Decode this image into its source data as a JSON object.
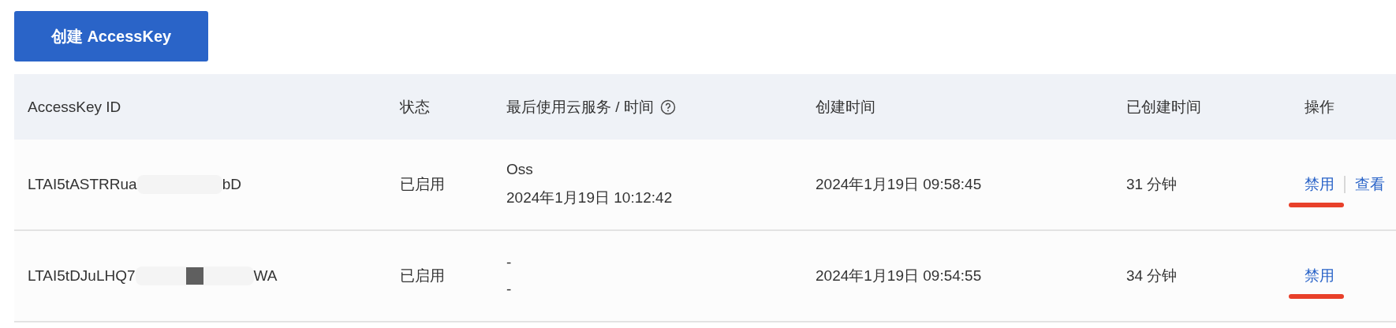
{
  "create_button": {
    "label": "创建 AccessKey"
  },
  "table": {
    "columns": [
      {
        "label": "AccessKey ID",
        "help": false
      },
      {
        "label": "状态",
        "help": false
      },
      {
        "label": "最后使用云服务 / 时间",
        "help": true
      },
      {
        "label": "创建时间",
        "help": false
      },
      {
        "label": "已创建时间",
        "help": false
      },
      {
        "label": "操作",
        "help": false
      }
    ],
    "rows": [
      {
        "id_start": "LTAI5tASTRRua",
        "id_end": "bD",
        "redaction": {
          "kind": "blur"
        },
        "status": "已启用",
        "last_service": "Oss",
        "last_time": "2024年1月19日 10:12:42",
        "created": "2024年1月19日 09:58:45",
        "age": "31 分钟",
        "actions": [
          {
            "label": "禁用",
            "underlined": true
          },
          {
            "label": "查看",
            "underlined": false
          }
        ]
      },
      {
        "id_start": "LTAI5tDJuLHQ7",
        "id_end": "WA",
        "redaction": {
          "kind": "block"
        },
        "status": "已启用",
        "last_service": "-",
        "last_time": "-",
        "created": "2024年1月19日 09:54:55",
        "age": "34 分钟",
        "actions": [
          {
            "label": "禁用",
            "underlined": true
          }
        ]
      }
    ]
  }
}
